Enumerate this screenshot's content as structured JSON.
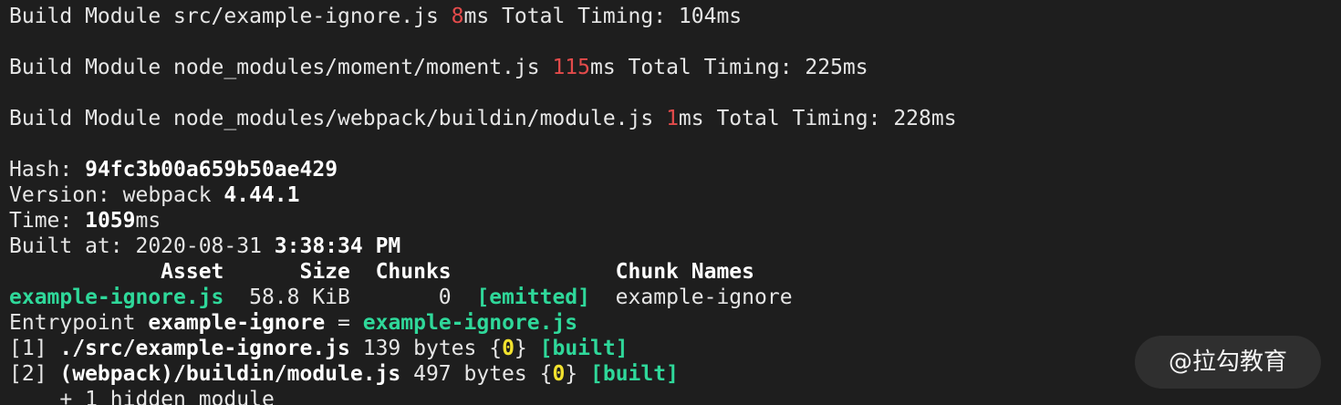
{
  "build_lines": [
    {
      "prefix": "Build Module src/example-ignore.js ",
      "ms": "8",
      "suffix": "ms Total Timing: 104ms"
    },
    {
      "prefix": "Build Module node_modules/moment/moment.js ",
      "ms": "115",
      "suffix": "ms Total Timing: 225ms"
    },
    {
      "prefix": "Build Module node_modules/webpack/buildin/module.js ",
      "ms": "1",
      "suffix": "ms Total Timing: 228ms"
    }
  ],
  "summary": {
    "hash_label": "Hash: ",
    "hash_value": "94fc3b00a659b50ae429",
    "version_label": "Version: webpack ",
    "version_value": "4.44.1",
    "time_label": "Time: ",
    "time_value": "1059",
    "time_unit": "ms",
    "built_label": "Built at: 2020-08-31 ",
    "built_time": "3:38:34 PM"
  },
  "asset_table": {
    "header": "            Asset      Size  Chunks             Chunk Names",
    "asset_name": "example-ignore.js",
    "asset_rest_1": "  58.8 KiB       0  ",
    "emitted": "[emitted]",
    "asset_rest_2": "  example-ignore"
  },
  "entrypoint": {
    "label": "Entrypoint ",
    "name": "example-ignore",
    "eq": " = ",
    "file": "example-ignore.js"
  },
  "modules": [
    {
      "id": "[1] ",
      "path": "./src/example-ignore.js",
      "size": " 139 bytes {",
      "chunk": "0",
      "close": "} ",
      "built": "[built]"
    },
    {
      "id": "[2] ",
      "path": "(webpack)/buildin/module.js",
      "size": " 497 bytes {",
      "chunk": "0",
      "close": "} ",
      "built": "[built]"
    }
  ],
  "hidden_module": "    + 1 hidden module",
  "watermark": "@拉勾教育",
  "colors": {
    "background": "#1e1e1e",
    "timing_red": "#e34b4b",
    "success_green": "#2fd89a",
    "chunk_yellow": "#f2e22e"
  }
}
